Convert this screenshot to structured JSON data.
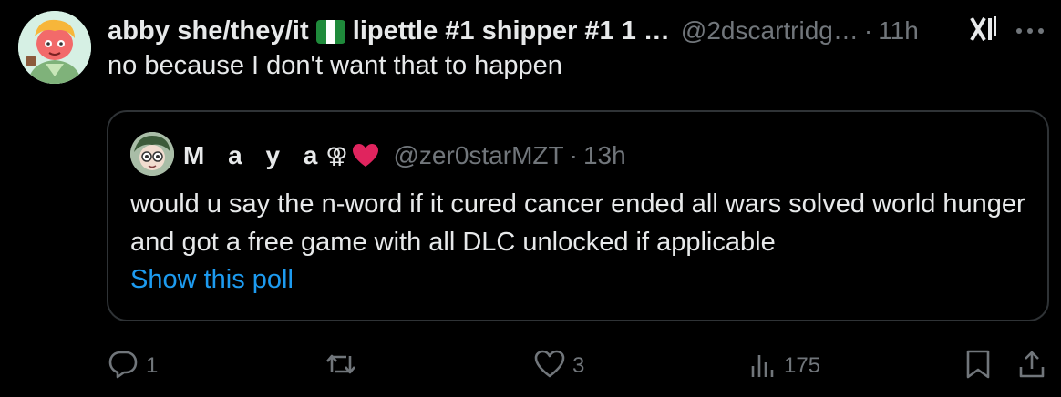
{
  "tweet": {
    "display_name": "abby she/they/it",
    "name_rest": "lipettle #1 shipper #1 1 …",
    "handle": "@2dscartridg…",
    "separator": "·",
    "time": "11h",
    "text": "no because I don't want that to happen"
  },
  "quote": {
    "display_name": "M a y a",
    "symbol": "⚢",
    "handle": "@zer0starMZT",
    "separator": "·",
    "time": "13h",
    "text": "would u say the n-word if it cured cancer ended all wars solved world hunger and got a free game with all DLC unlocked if applicable",
    "link": "Show this poll"
  },
  "actions": {
    "reply_count": "1",
    "repost_count": "",
    "like_count": "3",
    "views_count": "175"
  },
  "icons": [
    "grok-icon",
    "more-icon",
    "reply-icon",
    "repost-icon",
    "like-icon",
    "views-icon",
    "bookmark-icon",
    "share-icon"
  ],
  "colors": {
    "background": "#000000",
    "text": "#e7e9ea",
    "muted": "#71767b",
    "link": "#1d9bf0",
    "border": "#2f3336",
    "heart": "#e0245e"
  }
}
